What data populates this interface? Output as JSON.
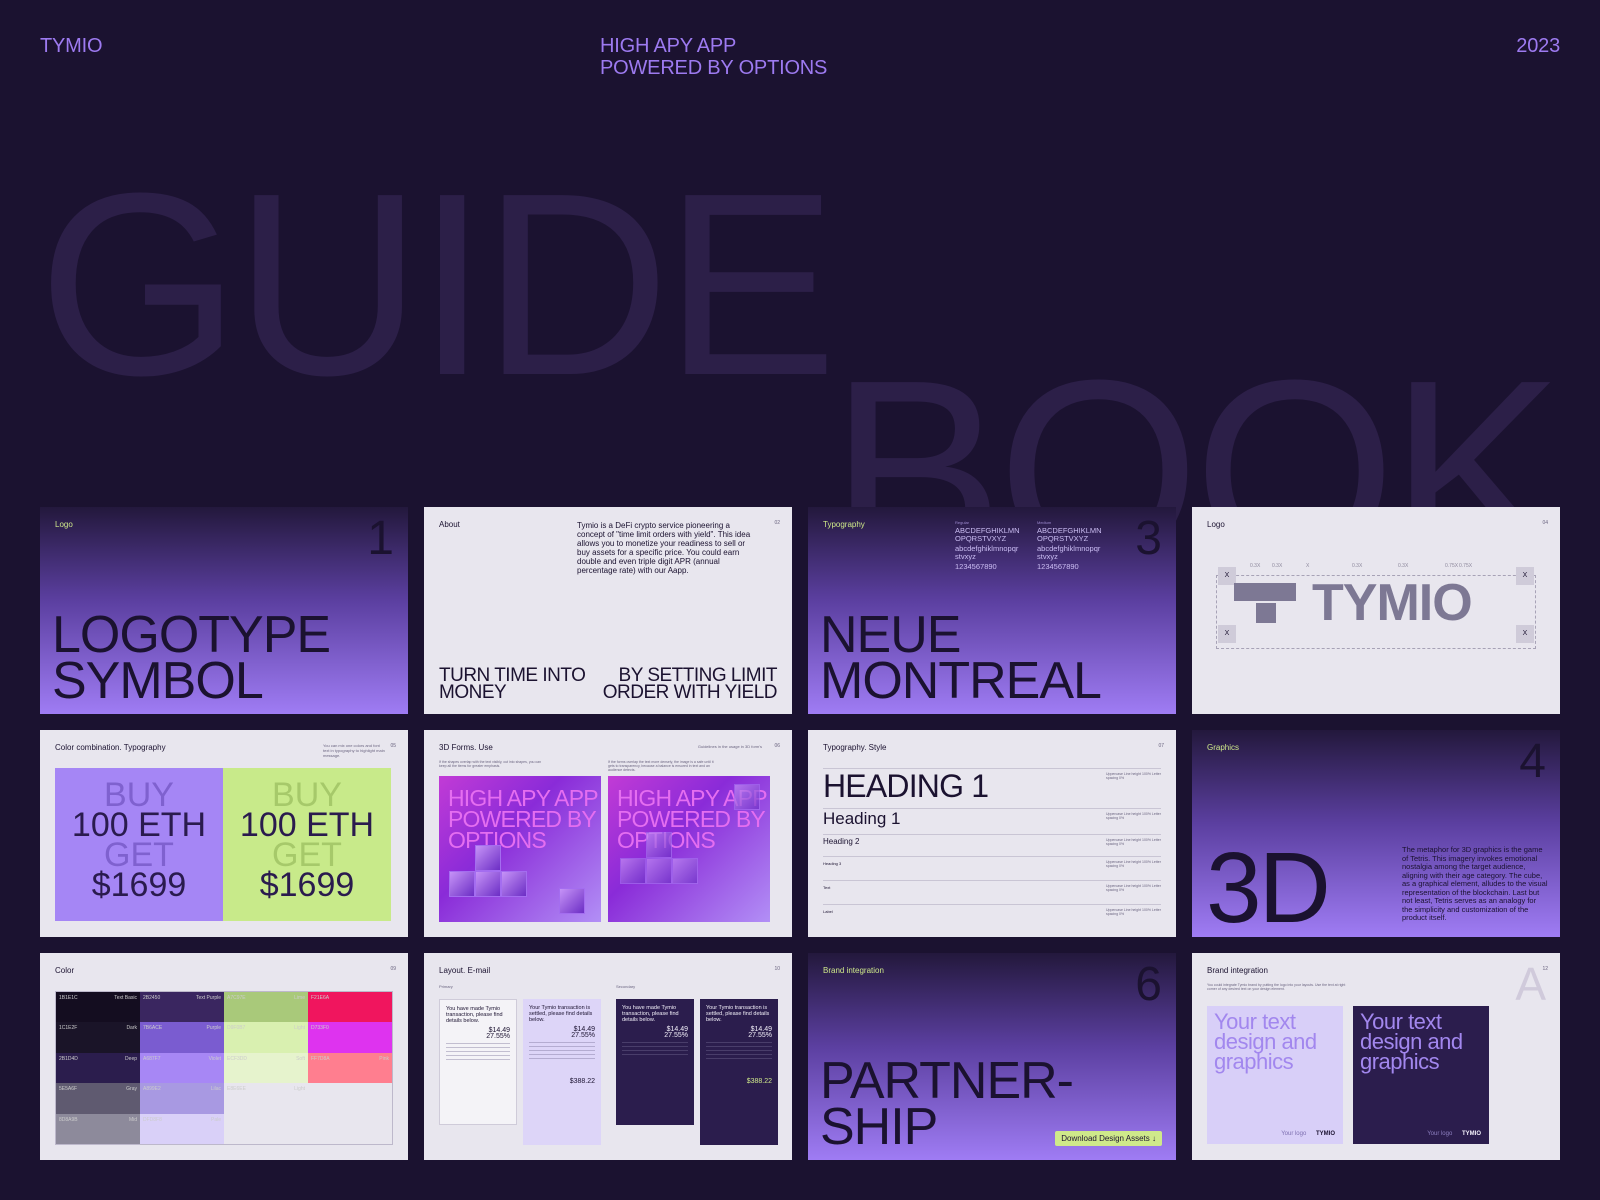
{
  "header": {
    "brand": "TYMIO",
    "tagline_line1": "HIGH APY APP",
    "tagline_line2": "POWERED BY OPTIONS",
    "year": "2023"
  },
  "hero": {
    "word1": "GUIDE",
    "word2": "BOOK"
  },
  "cards": {
    "logo1": {
      "tag": "Logo",
      "number": "1",
      "title_line1": "LOGOTYPE",
      "title_line2": "SYMBOL"
    },
    "about": {
      "tag": "About",
      "page": "02",
      "body": "Tymio is a DeFi crypto service pioneering a concept of \"time limit orders with yield\". This idea allows you to monetize your readiness to sell or buy assets for a specific price. You could earn double and even triple digit APR (annual percentage rate) with our Aapp.",
      "left_line1": "TURN TIME INTO",
      "left_line2": "MONEY",
      "right_line1": "BY SETTING LIMIT",
      "right_line2": "ORDER WITH YIELD"
    },
    "typography": {
      "tag": "Typography",
      "number": "3",
      "regular_label": "Regular",
      "medium_label": "Medium",
      "upper1": "ABCDEFGHIKLMN",
      "upper2": "OPQRSTVXYZ",
      "lower1": "abcdefghiklmnopqr",
      "lower2": "stvxyz",
      "digits": "1234567890",
      "title_line1": "NEUE",
      "title_line2": "MONTREAL"
    },
    "logo_construct": {
      "tag": "Logo",
      "page": "04",
      "wordmark": "TYMIO",
      "marks": [
        "0.3X",
        "0.3X",
        "X",
        "0.3X",
        "0.3X",
        "0.75X",
        "0.75X"
      ],
      "corner": "X"
    },
    "color_combo": {
      "tag": "Color combination. Typography",
      "note": "You can mix one colors and font text in typography to highlight main message.",
      "page": "05",
      "buy": "BUY",
      "amount": "100 ETH",
      "get": "GET",
      "price": "$1699"
    },
    "forms3d": {
      "tag": "3D Forms. Use",
      "page": "06",
      "note_left": "If the shapes overlap with the text visibly, cut into shapes, you can keep all the items for greater emphasis.",
      "note_right": "If the forms overlap the text more densely, the image is a safe until it gets to transparency, because a balance is ensured in text and an audience detects.",
      "label": "Guidelines in the usage in 3D form's",
      "text_line1": "HIGH APY APP",
      "text_line2": "POWERED BY",
      "text_line3": "OPTIONS"
    },
    "typo_style": {
      "tag": "Typography. Style",
      "page": "07",
      "h1_upper": "HEADING 1",
      "h1": "Heading 1",
      "h2": "Heading 2",
      "h3": "Heading 3",
      "text": "Text",
      "label": "Label",
      "spec": "Uppercase Line height 100% Letter spacing 0%"
    },
    "graphics": {
      "tag": "Graphics",
      "number": "4",
      "title": "3D",
      "body": "The metaphor for 3D graphics is the game of Tetris. This imagery invokes emotional nostalgia among the target audience, aligning with their age category. The cube, as a graphical element, alludes to the visual representation of the blockchain. Last but not least, Tetris serves as an analogy for the simplicity and customization of the product itself."
    },
    "color": {
      "tag": "Color",
      "page": "09",
      "swatches": [
        {
          "hex": "1B1E1C",
          "name": "Text Basic",
          "color": "#140d20"
        },
        {
          "hex": "2B2450",
          "name": "Text Purple",
          "color": "#3a2660"
        },
        {
          "hex": "A7C97E",
          "name": "Lime",
          "color": "#a9c97a"
        },
        {
          "hex": "F21E6A",
          "name": "",
          "color": "#f0155e"
        },
        {
          "hex": "1C1E2F",
          "name": "Dark",
          "color": "#1a1428"
        },
        {
          "hex": "7B6ACE",
          "name": "Purple",
          "color": "#7a5cd0"
        },
        {
          "hex": "D9F0B7",
          "name": "Light",
          "color": "#d9f0b0"
        },
        {
          "hex": "D733F0",
          "name": "",
          "color": "#de33ef"
        },
        {
          "hex": "2B1D4D",
          "name": "Deep",
          "color": "#2b1d4d"
        },
        {
          "hex": "A687F7",
          "name": "Violet",
          "color": "#a787f5"
        },
        {
          "hex": "ECF3DD",
          "name": "Soft",
          "color": "#e6f3cd"
        },
        {
          "hex": "FF7D8A",
          "name": "Pink",
          "color": "#ff7e8f"
        },
        {
          "hex": "5E5A6F",
          "name": "Gray",
          "color": "#5f5a70"
        },
        {
          "hex": "A899E2",
          "name": "Lilac",
          "color": "#a899e2"
        },
        {
          "hex": "E8E6EE",
          "name": "Light",
          "color": "#e8e6ee"
        },
        {
          "hex": "",
          "name": "",
          "color": "#e8e6ee"
        },
        {
          "hex": "8D8A9B",
          "name": "Mid",
          "color": "#8d8a9b"
        },
        {
          "hex": "DFD8F8",
          "name": "Pale",
          "color": "#d9d0f8"
        },
        {
          "hex": "",
          "name": "",
          "color": "#e8e6ee"
        },
        {
          "hex": "",
          "name": "",
          "color": "#e8e6ee"
        }
      ]
    },
    "email": {
      "tag": "Layout. E-mail",
      "page": "10",
      "primary": "Primary",
      "secondary": "Secondary",
      "title_a": "You have made Tymio transaction, please find details below.",
      "title_b": "Your Tymio transaction is settled, please find details below.",
      "amount": "$14.49",
      "apy": "27.55%",
      "total": "$388.22"
    },
    "partnership": {
      "tag": "Brand integration",
      "number": "6",
      "title_line1": "PARTNER-",
      "title_line2": "SHIP",
      "button": "Download Design Assets"
    },
    "brand": {
      "tag": "Brand integration",
      "page": "12",
      "letter": "A",
      "note": "You could integrate Tymio brand by putting the logo into your layouts. Use the text at right corner of any desired text on your design element.",
      "text_line1": "Your text",
      "text_line2": "design and",
      "text_line3": "graphics",
      "your_logo": "Your logo",
      "logo": "TYMIO"
    }
  }
}
